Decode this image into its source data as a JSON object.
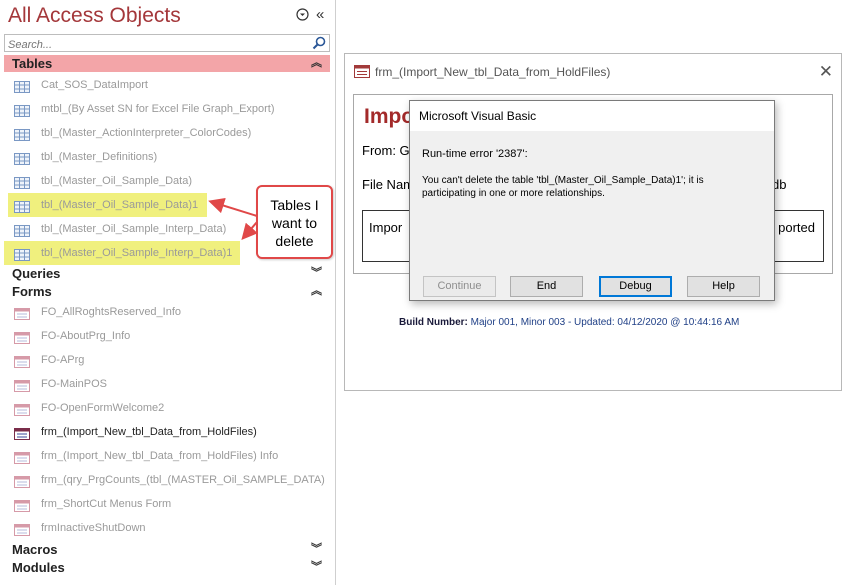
{
  "nav": {
    "title": "All Access Objects",
    "search_placeholder": "Search...",
    "groups": {
      "tables": "Tables",
      "queries": "Queries",
      "forms": "Forms",
      "macros": "Macros",
      "modules": "Modules"
    },
    "tables": [
      "Cat_SOS_DataImport",
      "mtbl_(By Asset SN for Excel File Graph_Export)",
      "tbl_(Master_ActionInterpreter_ColorCodes)",
      "tbl_(Master_Definitions)",
      "tbl_(Master_Oil_Sample_Data)",
      "tbl_(Master_Oil_Sample_Data)1",
      "tbl_(Master_Oil_Sample_Interp_Data)",
      "tbl_(Master_Oil_Sample_Interp_Data)1"
    ],
    "forms": [
      "FO_AllRoghtsReserved_Info",
      "FO-AboutPrg_Info",
      "FO-APrg",
      "FO-MainPOS",
      "FO-OpenFormWelcome2",
      "frm_(Import_New_tbl_Data_from_HoldFiles)",
      "frm_(Import_New_tbl_Data_from_HoldFiles) Info",
      "frm_(qry_PrgCounts_(tbl_(MASTER_Oil_SAMPLE_DATA)",
      "frm_ShortCut Menus Form",
      "frmInactiveShutDown"
    ]
  },
  "callout": {
    "line1": "Tables I",
    "line2": "want to",
    "line3": "delete"
  },
  "form": {
    "title": "frm_(Import_New_tbl_Data_from_HoldFiles)",
    "heading": "Impo",
    "from": "From: G",
    "file": "File Nam",
    "db_suffix": "db",
    "import_left": "Impor",
    "import_right": "ported",
    "build_label": "Build Number:",
    "build_value": " Major 001, Minor 003 - Updated: 04/12/2020 @ 10:44:16 AM"
  },
  "dialog": {
    "title": "Microsoft Visual Basic",
    "error": "Run-time error '2387':",
    "message": "You can't delete the table 'tbl_(Master_Oil_Sample_Data)1'; it is participating in one or more relationships.",
    "buttons": {
      "continue": "Continue",
      "end": "End",
      "debug": "Debug",
      "help": "Help"
    }
  },
  "colors": {
    "title": "#a4373a",
    "tables_header": "#f3a5a8",
    "highlight": "#f0f07e",
    "callout_border": "#e04848",
    "default_button": "#0078d7"
  }
}
